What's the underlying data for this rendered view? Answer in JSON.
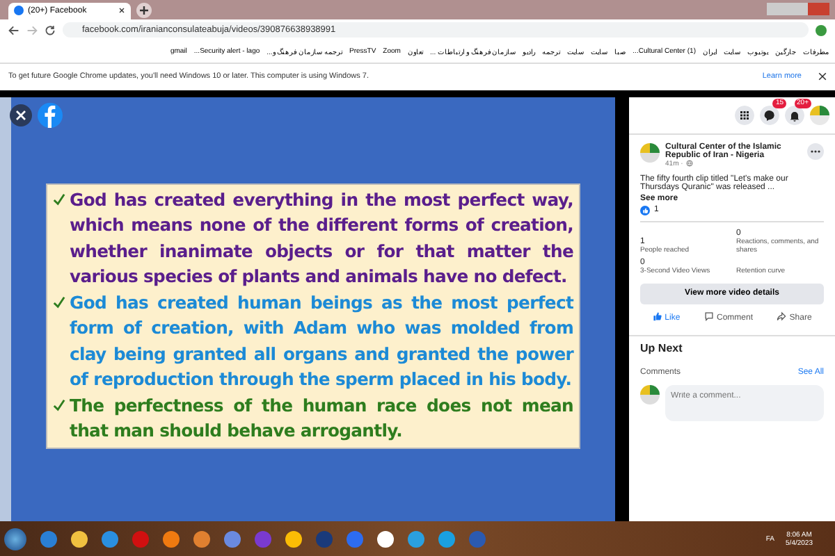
{
  "browser": {
    "tab": {
      "title": "(20+) Facebook",
      "selected": true
    },
    "address": "facebook.com/iranianconsulateabuja/videos/390876638938991",
    "bookmarks": [
      "مطرفات",
      "جارگین",
      "یوتیوب",
      "سایت",
      "ایران",
      "(1) Cultural Center...",
      "صبا",
      "سایت",
      "سایت",
      "ترجمه",
      "رادیو",
      "سازمان فرهنگ و ارتباطات ...",
      "تعاون",
      "Zoom",
      "PressTV",
      "ترجمه سازمان فرهنگ و...",
      "Security alert - lago...",
      "gmail"
    ],
    "notice": {
      "text": "To get future Google Chrome updates, you'll need Windows 10 or later. This computer is using Windows 7.",
      "link": "Learn more"
    }
  },
  "slide": {
    "bullets": [
      {
        "text": "God has created everything in the most perfect way, which means none of the different forms of creation, whether inanimate objects or for that matter the various species of plants and animals have no defect.",
        "color": "#5a1e8c"
      },
      {
        "text": "God has created human beings as the most perfect form of creation, with Adam who was molded from clay being granted all organs and granted the power of reproduction through the sperm placed in his body.",
        "color": "#1c8ad6"
      },
      {
        "text": "The perfectness of the human race does not mean that man should behave arrogantly.",
        "color": "#2e7d1e"
      }
    ]
  },
  "header": {
    "messenger_badge": "15",
    "notifications_badge": "20+"
  },
  "post": {
    "page": "Cultural Center of the Islamic Republic of Iran - Nigeria",
    "time": "41m ·",
    "text": "The fifty fourth clip titled \"Let's make our Thursdays Quranic\" was released ...",
    "see_more": "See more",
    "likes": "1",
    "stats": [
      {
        "value": "1",
        "label": "People reached"
      },
      {
        "value": "0",
        "label": "Reactions, comments, and shares"
      },
      {
        "value": "0",
        "label": "3-Second Video Views"
      },
      {
        "label": "Retention curve"
      }
    ],
    "details_button": "View more video details",
    "actions": [
      "Like",
      "Comment",
      "Share"
    ]
  },
  "up_next": "Up Next",
  "comments": {
    "title": "Comments",
    "see_all": "See All",
    "placeholder": "Write a comment..."
  },
  "tray": {
    "language": "FA",
    "time": "8:06 AM",
    "date": "5/4/2023"
  }
}
